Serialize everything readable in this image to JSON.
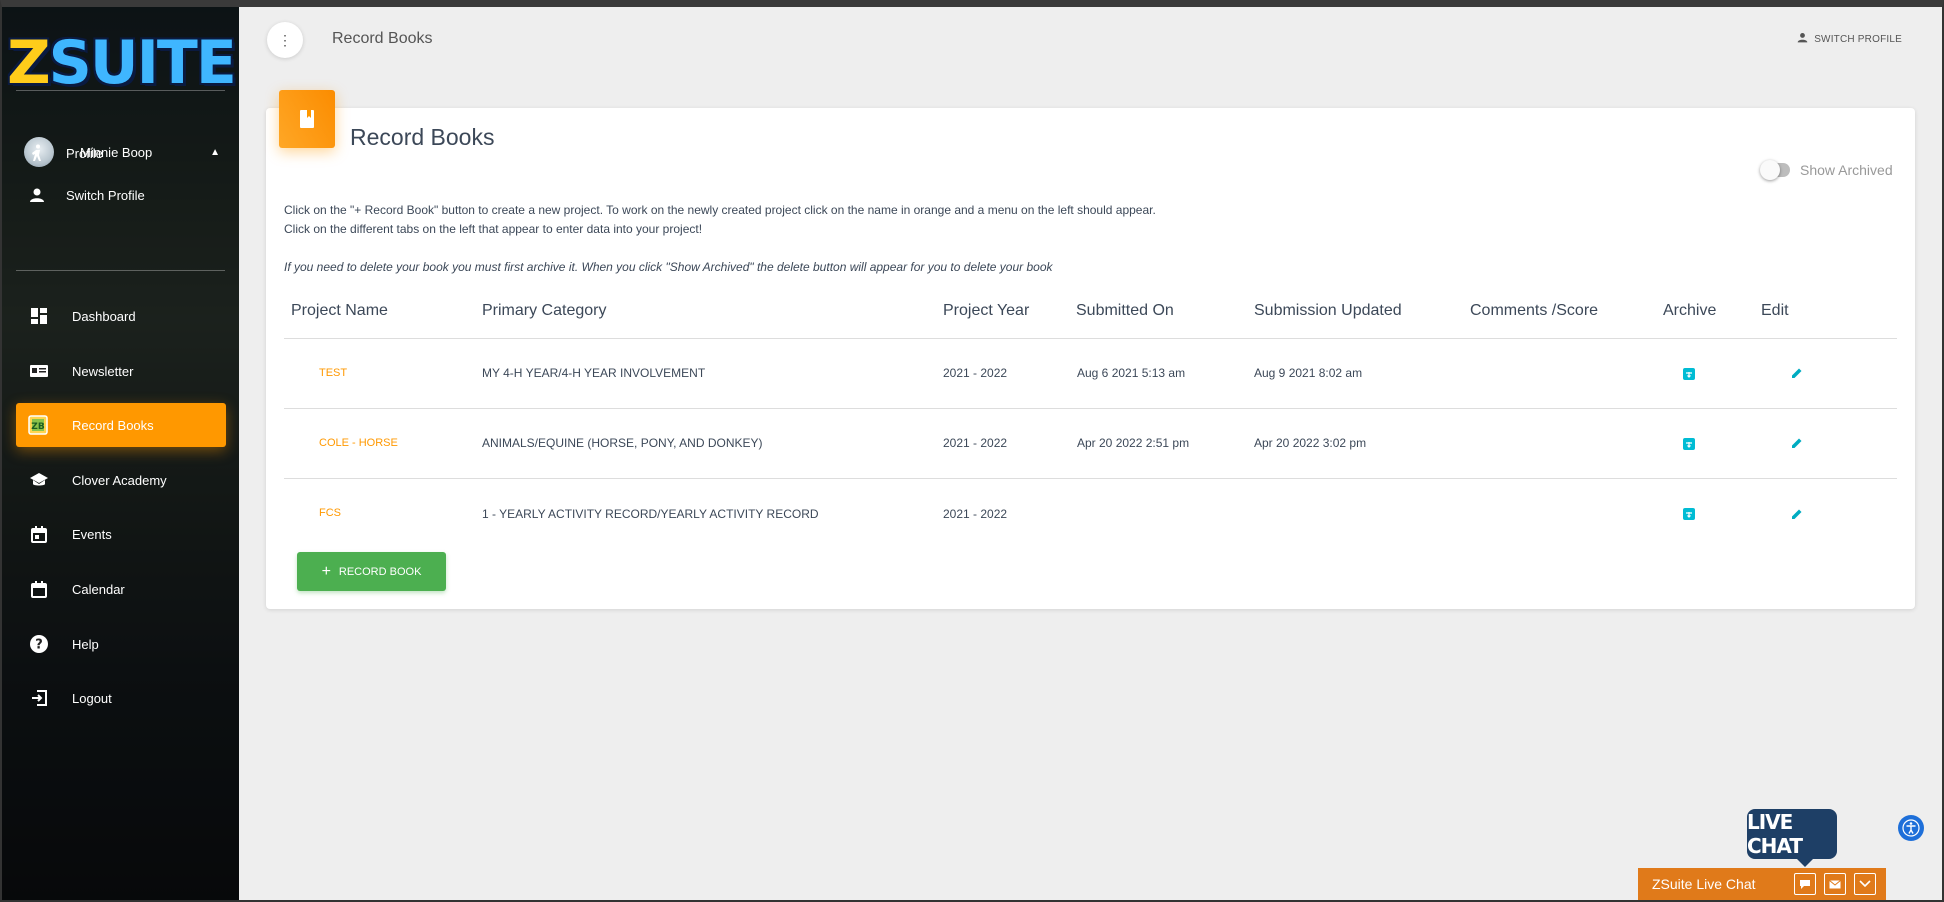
{
  "app": {
    "logo_text": "ZSUITE"
  },
  "sidebar": {
    "user": {
      "name": "Minnie Boop"
    },
    "sub_items": [
      {
        "label": "Profile",
        "icon": "person-walking-icon"
      },
      {
        "label": "Switch Profile",
        "icon": "person-icon"
      }
    ],
    "nav": [
      {
        "label": "Dashboard",
        "icon": "dashboard-icon"
      },
      {
        "label": "Newsletter",
        "icon": "newsletter-icon"
      },
      {
        "label": "Record Books",
        "icon": "record-books-icon",
        "active": true
      },
      {
        "label": "Clover Academy",
        "icon": "school-icon"
      },
      {
        "label": "Events",
        "icon": "event-icon"
      },
      {
        "label": "Calendar",
        "icon": "calendar-icon"
      },
      {
        "label": "Help",
        "icon": "help-icon"
      },
      {
        "label": "Logout",
        "icon": "logout-icon"
      }
    ]
  },
  "topbar": {
    "title": "Record Books",
    "switch_profile": "SWITCH PROFILE"
  },
  "card": {
    "title": "Record Books",
    "show_archived_label": "Show Archived",
    "instructions": [
      "Click on the \"+ Record Book\" button to create a new project. To work on the newly created project click on the name in orange and a menu on the left should appear.",
      "Click on the different tabs on the left that appear to enter data into your project!"
    ],
    "note": "If you need to delete your book you must first archive it. When you click \"Show Archived\" the delete button will appear for you to delete your book",
    "table": {
      "headers": [
        "Project Name",
        "Primary Category",
        "Project Year",
        "Submitted On",
        "Submission Updated",
        "Comments /Score",
        "Archive",
        "Edit"
      ],
      "rows": [
        {
          "name": "TEST",
          "category": "MY 4-H YEAR/4-H YEAR INVOLVEMENT",
          "year": "2021 - 2022",
          "submitted": "Aug 6 2021 5:13 am",
          "updated": "Aug 9 2021 8:02 am",
          "comments": ""
        },
        {
          "name": "COLE - HORSE",
          "category": "ANIMALS/EQUINE (HORSE, PONY, AND DONKEY)",
          "year": "2021 - 2022",
          "submitted": "Apr 20 2022 2:51 pm",
          "updated": "Apr 20 2022 3:02 pm",
          "comments": ""
        },
        {
          "name": "FCS",
          "category": "1 - YEARLY ACTIVITY RECORD/YEARLY ACTIVITY RECORD",
          "year": "2021 - 2022",
          "submitted": "",
          "updated": "",
          "comments": ""
        }
      ]
    },
    "add_button": "RECORD BOOK"
  },
  "chat": {
    "bubble": "LIVE CHAT",
    "bar_label": "ZSuite Live Chat"
  },
  "colors": {
    "accent": "#ff9800",
    "success": "#4caf50",
    "info": "#00bcd4",
    "chat": "#e07a1a"
  }
}
